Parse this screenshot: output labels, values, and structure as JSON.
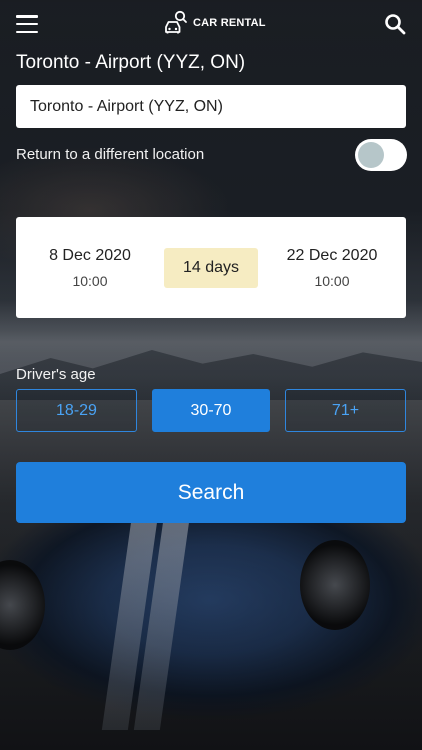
{
  "brand": {
    "name": "CAR RENTAL",
    "icon": "car-search-icon"
  },
  "header": {
    "menu_icon": "hamburger-menu-icon",
    "search_icon": "search-icon"
  },
  "location": {
    "title": "Toronto - Airport (YYZ, ON)",
    "input_value": "Toronto - Airport (YYZ, ON)",
    "return_label": "Return to a different location",
    "return_different": false
  },
  "dates": {
    "pickup_date": "8 Dec 2020",
    "pickup_time": "10:00",
    "duration": "14 days",
    "return_date": "22 Dec 2020",
    "return_time": "10:00"
  },
  "driver_age": {
    "label": "Driver's age",
    "options": [
      "18-29",
      "30-70",
      "71+"
    ],
    "selected": "30-70"
  },
  "search_button": "Search",
  "colors": {
    "accent": "#1f7fdc",
    "duration_pill": "#f6ecc2",
    "toggle_knob": "#b6c6c9"
  }
}
